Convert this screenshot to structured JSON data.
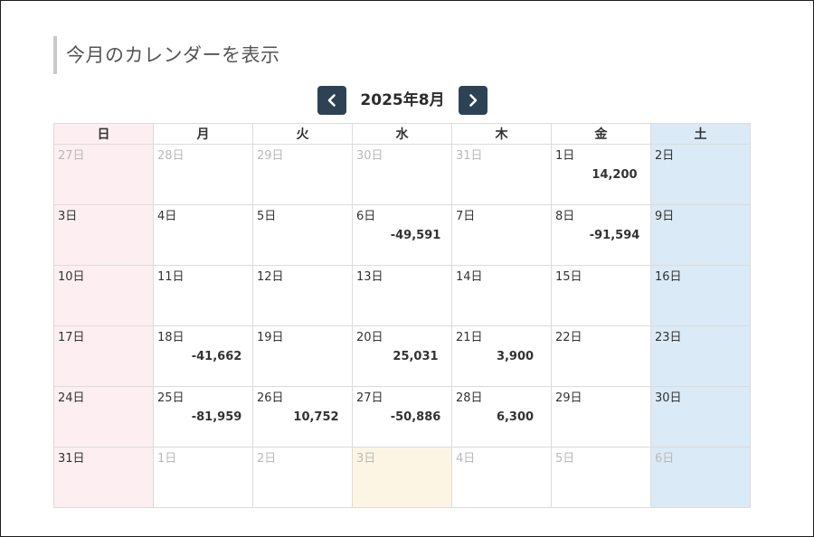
{
  "page_title": "今月のカレンダーを表示",
  "navigation": {
    "prev_icon": "chevron-left-icon",
    "next_icon": "chevron-right-icon",
    "month_label": "2025年8月"
  },
  "colors": {
    "nav_button": "#2e4256",
    "sunday_bg": "#fdeef2",
    "saturday_bg": "#daeaf6",
    "today_bg": "#fdf5e4"
  },
  "weekdays": [
    "日",
    "月",
    "火",
    "水",
    "木",
    "金",
    "土"
  ],
  "weeks": [
    [
      {
        "day": "27日",
        "other": true,
        "amount": ""
      },
      {
        "day": "28日",
        "other": true,
        "amount": ""
      },
      {
        "day": "29日",
        "other": true,
        "amount": ""
      },
      {
        "day": "30日",
        "other": true,
        "amount": ""
      },
      {
        "day": "31日",
        "other": true,
        "amount": ""
      },
      {
        "day": "1日",
        "other": false,
        "amount": "14,200"
      },
      {
        "day": "2日",
        "other": false,
        "amount": ""
      }
    ],
    [
      {
        "day": "3日",
        "other": false,
        "amount": ""
      },
      {
        "day": "4日",
        "other": false,
        "amount": ""
      },
      {
        "day": "5日",
        "other": false,
        "amount": ""
      },
      {
        "day": "6日",
        "other": false,
        "amount": "-49,591"
      },
      {
        "day": "7日",
        "other": false,
        "amount": ""
      },
      {
        "day": "8日",
        "other": false,
        "amount": "-91,594"
      },
      {
        "day": "9日",
        "other": false,
        "amount": ""
      }
    ],
    [
      {
        "day": "10日",
        "other": false,
        "amount": ""
      },
      {
        "day": "11日",
        "other": false,
        "amount": ""
      },
      {
        "day": "12日",
        "other": false,
        "amount": ""
      },
      {
        "day": "13日",
        "other": false,
        "amount": ""
      },
      {
        "day": "14日",
        "other": false,
        "amount": ""
      },
      {
        "day": "15日",
        "other": false,
        "amount": ""
      },
      {
        "day": "16日",
        "other": false,
        "amount": ""
      }
    ],
    [
      {
        "day": "17日",
        "other": false,
        "amount": ""
      },
      {
        "day": "18日",
        "other": false,
        "amount": "-41,662"
      },
      {
        "day": "19日",
        "other": false,
        "amount": ""
      },
      {
        "day": "20日",
        "other": false,
        "amount": "25,031"
      },
      {
        "day": "21日",
        "other": false,
        "amount": "3,900"
      },
      {
        "day": "22日",
        "other": false,
        "amount": ""
      },
      {
        "day": "23日",
        "other": false,
        "amount": ""
      }
    ],
    [
      {
        "day": "24日",
        "other": false,
        "amount": ""
      },
      {
        "day": "25日",
        "other": false,
        "amount": "-81,959"
      },
      {
        "day": "26日",
        "other": false,
        "amount": "10,752"
      },
      {
        "day": "27日",
        "other": false,
        "amount": "-50,886"
      },
      {
        "day": "28日",
        "other": false,
        "amount": "6,300"
      },
      {
        "day": "29日",
        "other": false,
        "amount": ""
      },
      {
        "day": "30日",
        "other": false,
        "amount": ""
      }
    ],
    [
      {
        "day": "31日",
        "other": false,
        "amount": ""
      },
      {
        "day": "1日",
        "other": true,
        "amount": ""
      },
      {
        "day": "2日",
        "other": true,
        "amount": ""
      },
      {
        "day": "3日",
        "other": true,
        "amount": "",
        "today": true
      },
      {
        "day": "4日",
        "other": true,
        "amount": ""
      },
      {
        "day": "5日",
        "other": true,
        "amount": ""
      },
      {
        "day": "6日",
        "other": true,
        "amount": ""
      }
    ]
  ]
}
